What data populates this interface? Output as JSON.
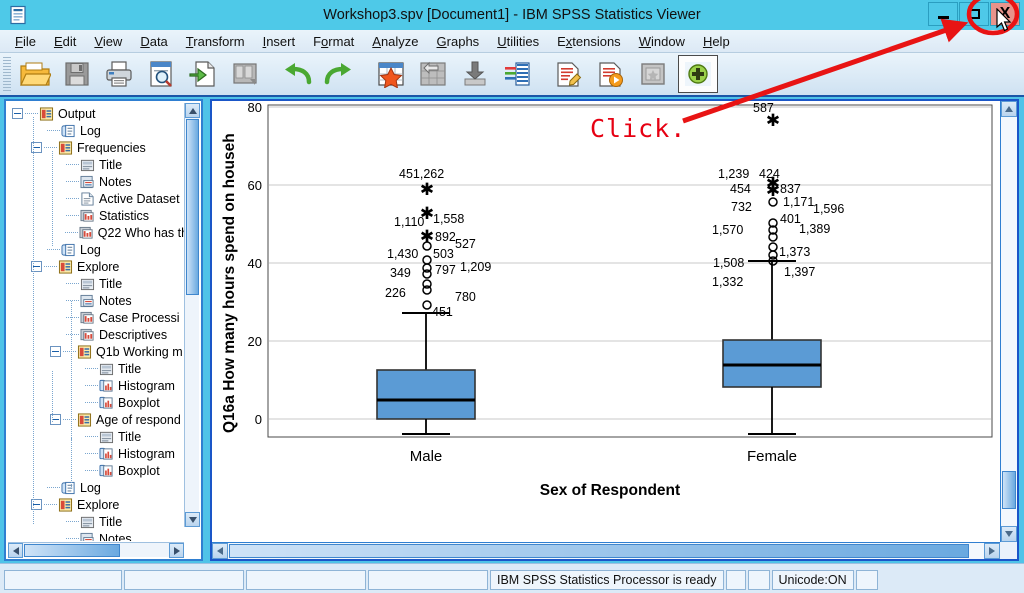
{
  "window": {
    "title": "Workshop3.spv [Document1] - IBM SPSS Statistics Viewer",
    "app_icon": "spss-document-icon",
    "minimize_label": "Minimize",
    "maximize_label": "Maximize",
    "close_label": "X",
    "close_button_color": "#e8938b",
    "titlebar_color": "#4ec9e8"
  },
  "menubar": {
    "items": [
      {
        "label": "File",
        "mnemonic": "F"
      },
      {
        "label": "Edit",
        "mnemonic": "E"
      },
      {
        "label": "View",
        "mnemonic": "V"
      },
      {
        "label": "Data",
        "mnemonic": "D"
      },
      {
        "label": "Transform",
        "mnemonic": "T"
      },
      {
        "label": "Insert",
        "mnemonic": "I"
      },
      {
        "label": "Format",
        "mnemonic": "o"
      },
      {
        "label": "Analyze",
        "mnemonic": "A"
      },
      {
        "label": "Graphs",
        "mnemonic": "G"
      },
      {
        "label": "Utilities",
        "mnemonic": "U"
      },
      {
        "label": "Extensions",
        "mnemonic": "x"
      },
      {
        "label": "Window",
        "mnemonic": "W"
      },
      {
        "label": "Help",
        "mnemonic": "H"
      }
    ]
  },
  "toolbar": {
    "buttons": [
      {
        "name": "open-file-icon",
        "tooltip": "Open"
      },
      {
        "name": "save-icon",
        "tooltip": "Save",
        "disabled": true
      },
      {
        "name": "print-icon",
        "tooltip": "Print"
      },
      {
        "name": "print-preview-icon",
        "tooltip": "Print Preview"
      },
      {
        "name": "export-icon",
        "tooltip": "Export"
      },
      {
        "name": "dialog-recall-icon",
        "tooltip": "Recall Dialogs",
        "disabled": true
      },
      {
        "name": "undo-icon",
        "tooltip": "Undo"
      },
      {
        "name": "redo-icon",
        "tooltip": "Redo"
      },
      {
        "name": "goto-data-icon",
        "tooltip": "Go To Data"
      },
      {
        "name": "goto-case-icon",
        "tooltip": "Go To Case",
        "disabled": true
      },
      {
        "name": "insert-footnote-icon",
        "tooltip": "Insert"
      },
      {
        "name": "variables-icon",
        "tooltip": "Variables"
      },
      {
        "name": "insert-syntax-icon",
        "tooltip": "Insert Syntax"
      },
      {
        "name": "run-script-icon",
        "tooltip": "Run Script"
      },
      {
        "name": "hide-show-icon",
        "tooltip": "Hide/Show",
        "disabled": true
      },
      {
        "name": "add-object-icon",
        "tooltip": "Add",
        "selected": true
      }
    ]
  },
  "outline": {
    "items": [
      {
        "label": "Output",
        "depth": 0,
        "icon": "output-icon",
        "expander": "minus"
      },
      {
        "label": "Log",
        "depth": 1,
        "icon": "log-icon",
        "expander": "none"
      },
      {
        "label": "Frequencies",
        "depth": 1,
        "icon": "output-icon",
        "expander": "minus"
      },
      {
        "label": "Title",
        "depth": 2,
        "icon": "title-icon",
        "expander": "none"
      },
      {
        "label": "Notes",
        "depth": 2,
        "icon": "notes-icon",
        "expander": "none"
      },
      {
        "label": "Active Dataset",
        "depth": 2,
        "icon": "page-icon",
        "expander": "none"
      },
      {
        "label": "Statistics",
        "depth": 2,
        "icon": "table-icon",
        "expander": "none"
      },
      {
        "label": "Q22 Who has th",
        "depth": 2,
        "icon": "table-icon",
        "expander": "none"
      },
      {
        "label": "Log",
        "depth": 1,
        "icon": "log-icon",
        "expander": "none"
      },
      {
        "label": "Explore",
        "depth": 1,
        "icon": "output-icon",
        "expander": "minus"
      },
      {
        "label": "Title",
        "depth": 2,
        "icon": "title-icon",
        "expander": "none"
      },
      {
        "label": "Notes",
        "depth": 2,
        "icon": "notes-icon",
        "expander": "none"
      },
      {
        "label": "Case Processi",
        "depth": 2,
        "icon": "table-icon",
        "expander": "none"
      },
      {
        "label": "Descriptives",
        "depth": 2,
        "icon": "table-icon",
        "expander": "none"
      },
      {
        "label": "Q1b Working m",
        "depth": 2,
        "icon": "output-icon",
        "expander": "minus"
      },
      {
        "label": "Title",
        "depth": 3,
        "icon": "title-icon",
        "expander": "none"
      },
      {
        "label": "Histogram",
        "depth": 3,
        "icon": "chart-icon",
        "expander": "none"
      },
      {
        "label": "Boxplot",
        "depth": 3,
        "icon": "chart-icon",
        "expander": "none"
      },
      {
        "label": "Age of respond",
        "depth": 2,
        "icon": "output-icon",
        "expander": "minus"
      },
      {
        "label": "Title",
        "depth": 3,
        "icon": "title-icon",
        "expander": "none"
      },
      {
        "label": "Histogram",
        "depth": 3,
        "icon": "chart-icon",
        "expander": "none"
      },
      {
        "label": "Boxplot",
        "depth": 3,
        "icon": "chart-icon",
        "expander": "none"
      },
      {
        "label": "Log",
        "depth": 1,
        "icon": "log-icon",
        "expander": "none"
      },
      {
        "label": "Explore",
        "depth": 1,
        "icon": "output-icon",
        "expander": "minus"
      },
      {
        "label": "Title",
        "depth": 2,
        "icon": "title-icon",
        "expander": "none"
      },
      {
        "label": "Notes",
        "depth": 2,
        "icon": "notes-icon",
        "expander": "none"
      }
    ]
  },
  "annotation": {
    "text": "Click.",
    "color": "#e60012",
    "target": "window-close-button"
  },
  "statusbar": {
    "processor_status": "IBM SPSS Statistics Processor is ready",
    "unicode_status": "Unicode:ON"
  },
  "chart_data": {
    "type": "boxplot",
    "title": "",
    "xlabel": "Sex of Respondent",
    "ylabel": "Q16a How many hours spend on househ",
    "categories": [
      "Male",
      "Female"
    ],
    "ylim": [
      -5,
      82
    ],
    "yticks": [
      0,
      20,
      40,
      60,
      80
    ],
    "grid": true,
    "legend": "none",
    "box_fill": "#5b9bd5",
    "box_stroke": "#1a1a1a",
    "boxes": [
      {
        "category": "Male",
        "q1": 5.0,
        "median": 8.0,
        "q3": 14.0,
        "whisker_low": 0.0,
        "whisker_high": 27.0,
        "outliers": [
          {
            "value": 63.0,
            "labels": [
              "451",
              "262"
            ],
            "marker": "star"
          },
          {
            "value": 55.5,
            "labels": [
              "1,558"
            ],
            "marker": "star"
          },
          {
            "value": 48.0,
            "labels": [
              "1,110",
              "892"
            ],
            "marker": "star"
          },
          {
            "value": 46.0,
            "labels": [
              "527"
            ],
            "marker": "circle"
          },
          {
            "value": 42.5,
            "labels": [
              "1,430",
              "503"
            ],
            "marker": "circle"
          },
          {
            "value": 40.5,
            "labels": [
              "797",
              "1,209"
            ],
            "marker": "circle"
          },
          {
            "value": 39.5,
            "labels": [],
            "marker": "circle"
          },
          {
            "value": 36.5,
            "labels": [
              "349"
            ],
            "marker": "circle"
          },
          {
            "value": 35.5,
            "labels": [],
            "marker": "circle"
          },
          {
            "value": 29.5,
            "labels": [
              "226",
              "780",
              "451"
            ],
            "marker": "circle"
          }
        ]
      },
      {
        "category": "Female",
        "q1": 8.0,
        "median": 15.0,
        "q3": 20.0,
        "whisker_low": 0.0,
        "whisker_high": 41.0,
        "outliers": [
          {
            "value": 76.0,
            "labels": [
              "587"
            ],
            "marker": "star"
          },
          {
            "value": 61.5,
            "labels": [
              "1,239",
              "424"
            ],
            "marker": "star"
          },
          {
            "value": 60.0,
            "labels": [
              "454",
              "837"
            ],
            "marker": "star"
          },
          {
            "value": 57.5,
            "labels": [
              "732",
              "1,171",
              "1,596"
            ],
            "marker": "circle"
          },
          {
            "value": 50.5,
            "labels": [
              "401"
            ],
            "marker": "circle"
          },
          {
            "value": 49.0,
            "labels": [
              "1,570",
              "1,389"
            ],
            "marker": "circle"
          },
          {
            "value": 48.0,
            "labels": [],
            "marker": "circle"
          },
          {
            "value": 45.0,
            "labels": [],
            "marker": "circle"
          },
          {
            "value": 43.0,
            "labels": [
              "1,373"
            ],
            "marker": "circle"
          },
          {
            "value": 41.5,
            "labels": [
              "1,508"
            ],
            "marker": "circle"
          },
          {
            "value": 40.5,
            "labels": [
              "1,397",
              "1,332"
            ],
            "marker": "circle"
          }
        ]
      }
    ],
    "point_labels_male": [
      "451",
      "262",
      "1,558",
      "1,110",
      "892",
      "527",
      "1,430",
      "503",
      "797",
      "1,209",
      "349",
      "226",
      "780",
      "451"
    ],
    "point_labels_female": [
      "587",
      "1,239",
      "424",
      "454",
      "837",
      "732",
      "1,171",
      "1,596",
      "401",
      "1,570",
      "1,389",
      "1,373",
      "1,508",
      "1,397",
      "1,332"
    ]
  }
}
